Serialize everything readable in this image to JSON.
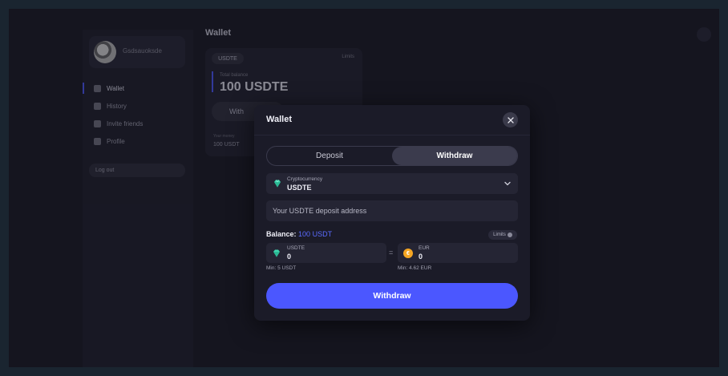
{
  "background": {
    "profile_name": "Gsdsauoksde",
    "nav": [
      {
        "label": "Wallet",
        "icon": "wallet-icon",
        "active": true
      },
      {
        "label": "History",
        "icon": "history-icon",
        "active": false
      },
      {
        "label": "Invite friends",
        "icon": "invite-icon",
        "active": false
      },
      {
        "label": "Profile",
        "icon": "user-icon",
        "active": false
      }
    ],
    "logout_label": "Log out",
    "page_title": "Wallet",
    "wallet_card": {
      "currency": "USDTE",
      "limits": "Limits",
      "total_label": "Total balance",
      "total_value": "100 USDTE",
      "button_label": "With",
      "small_label": "Your money",
      "small_value": "100 USDT"
    }
  },
  "modal": {
    "title": "Wallet",
    "tabs": [
      {
        "label": "Deposit",
        "active": false
      },
      {
        "label": "Withdraw",
        "active": true
      }
    ],
    "crypto_select": {
      "label": "Cryptocurrency",
      "value": "USDTE",
      "icon": "gem-icon"
    },
    "address_placeholder": "Your USDTE deposit address",
    "balance_label": "Balance:",
    "balance_value": "100 USDT",
    "limits_label": "Limits",
    "from": {
      "currency": "USDTE",
      "amount": "0",
      "min": "Min: 5 USDT"
    },
    "equals": "=",
    "to": {
      "currency": "EUR",
      "amount": "0",
      "min": "Min: 4.62 EUR",
      "icon_glyph": "€"
    },
    "withdraw_label": "Withdraw"
  },
  "colors": {
    "accent": "#4b57ff",
    "balance_highlight": "#5a6bff",
    "modal_bg": "#1b1b28",
    "field_bg": "#252534"
  }
}
